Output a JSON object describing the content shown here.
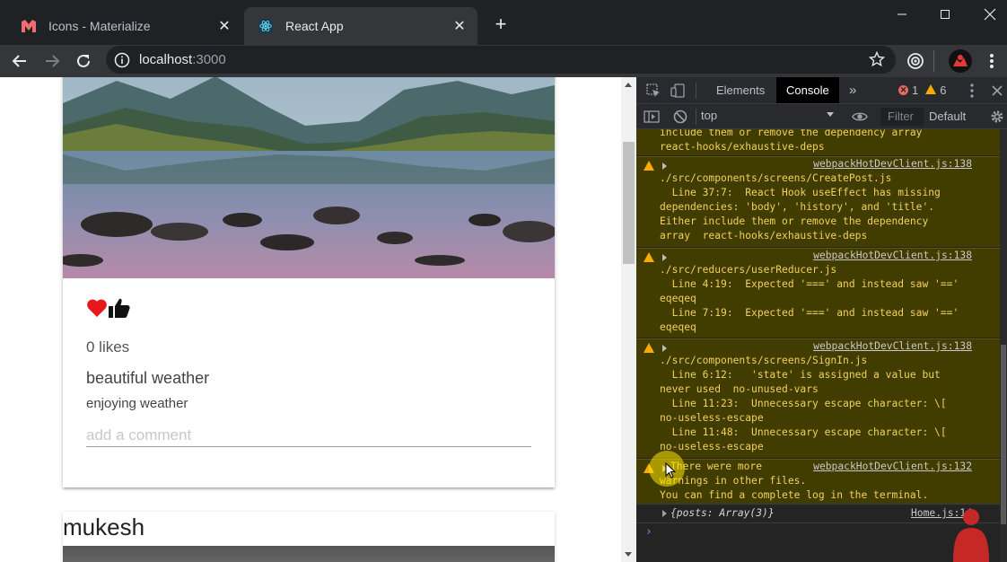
{
  "browser": {
    "tabs": [
      {
        "title": "Icons - Materialize",
        "favicon": "materialize-logo-icon",
        "active": false
      },
      {
        "title": "React App",
        "favicon": "react-logo-icon",
        "active": true
      }
    ],
    "close_glyph": "✕",
    "new_tab_glyph": "+",
    "url_host": "localhost",
    "url_port": ":3000"
  },
  "page": {
    "post1": {
      "likes": "0 likes",
      "title": "beautiful weather",
      "body": "enjoying weather",
      "comment_placeholder": "add a comment"
    },
    "post2": {
      "author": "mukesh"
    }
  },
  "devtools": {
    "tabs": [
      "Elements",
      "Console"
    ],
    "more_tabs_glyph": "»",
    "error_count": "1",
    "warning_count": "6",
    "context": "top",
    "filter_placeholder": "Filter",
    "levels": "Default",
    "messages": [
      {
        "source": "",
        "lines": [
          "include them or remove the dependency array",
          "react-hooks/exhaustive-deps"
        ]
      },
      {
        "source": "webpackHotDevClient.js:138",
        "lines": [
          "./src/components/screens/CreatePost.js",
          "  Line 37:7:  React Hook useEffect has missing",
          "dependencies: 'body', 'history', and 'title'.",
          "Either include them or remove the dependency",
          "array  react-hooks/exhaustive-deps"
        ]
      },
      {
        "source": "webpackHotDevClient.js:138",
        "lines": [
          "./src/reducers/userReducer.js",
          "  Line 4:19:  Expected '===' and instead saw '=='",
          "eqeqeq",
          "  Line 7:19:  Expected '===' and instead saw '=='",
          "eqeqeq"
        ]
      },
      {
        "source": "webpackHotDevClient.js:138",
        "lines": [
          "./src/components/screens/SignIn.js",
          "  Line 6:12:   'state' is assigned a value but",
          "never used  no-unused-vars",
          "  Line 11:23:  Unnecessary escape character: \\[",
          "no-useless-escape",
          "  Line 11:48:  Unnecessary escape character: \\[",
          "no-useless-escape"
        ]
      },
      {
        "source": "webpackHotDevClient.js:132",
        "lines": [
          "There were more",
          "warnings in other files.",
          "You can find a complete log in the terminal."
        ]
      }
    ],
    "log": {
      "text": "{posts: Array(3)}",
      "source": "Home.js:14"
    },
    "prompt": "›"
  },
  "colors": {
    "warning_bg": "#413c00",
    "warning_text": "#f2d25c",
    "heart": "#e8171c"
  }
}
